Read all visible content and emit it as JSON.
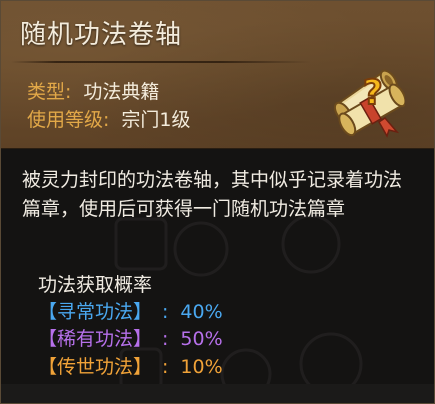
{
  "item": {
    "title": "随机功法卷轴",
    "type_label": "类型:",
    "type_value": "功法典籍",
    "level_label": "使用等级:",
    "level_value": "宗门1级",
    "icon": "scroll-question-icon"
  },
  "description": "被灵力封印的功法卷轴，其中似乎记录着功法篇章，使用后可获得一门随机功法篇章",
  "probability": {
    "title": "功法获取概率",
    "rows": [
      {
        "label": "【寻常功法】",
        "sep": ":",
        "value": "40%",
        "color": "#4aa8f0"
      },
      {
        "label": "【稀有功法】",
        "sep": ":",
        "value": "50%",
        "color": "#b670ea"
      },
      {
        "label": "【传世功法】",
        "sep": ":",
        "value": "10%",
        "color": "#f0a238"
      }
    ]
  },
  "colors": {
    "header_bg": "#6a4c2c",
    "meta_key": "#e2a848",
    "body_bg": "#141312"
  }
}
